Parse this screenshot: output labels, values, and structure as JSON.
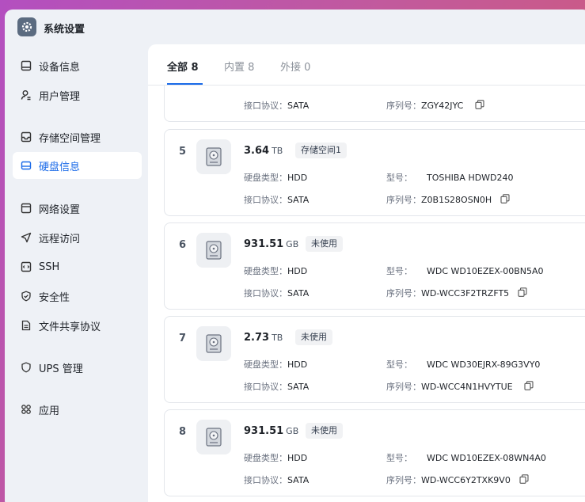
{
  "app": {
    "title": "系统设置"
  },
  "sidebar": {
    "items": [
      {
        "label": "设备信息",
        "icon": "device-info-icon"
      },
      {
        "label": "用户管理",
        "icon": "user-icon"
      },
      {
        "label": "存储空间管理",
        "icon": "storage-icon"
      },
      {
        "label": "硬盘信息",
        "icon": "disk-icon",
        "active": true
      },
      {
        "label": "网络设置",
        "icon": "network-icon"
      },
      {
        "label": "远程访问",
        "icon": "send-icon"
      },
      {
        "label": "SSH",
        "icon": "code-icon"
      },
      {
        "label": "安全性",
        "icon": "shield-icon"
      },
      {
        "label": "文件共享协议",
        "icon": "document-icon"
      },
      {
        "label": "UPS 管理",
        "icon": "ups-shield-icon"
      },
      {
        "label": "应用",
        "icon": "apps-icon"
      }
    ]
  },
  "tabs": [
    {
      "label": "全部 8",
      "active": true
    },
    {
      "label": "内置 8"
    },
    {
      "label": "外接 0"
    }
  ],
  "labels": {
    "disk_type": "硬盘类型：",
    "model": "型号：",
    "interface": "接口协议：",
    "serial": "序列号："
  },
  "partial_disk": {
    "interface": "SATA",
    "serial": "ZGY42JYC"
  },
  "disks": [
    {
      "index": "5",
      "size": "3.64",
      "unit": "TB",
      "status": "存储空间1",
      "type": "HDD",
      "model": "TOSHIBA HDWD240",
      "interface": "SATA",
      "serial": "Z0B1S28OSN0H"
    },
    {
      "index": "6",
      "size": "931.51",
      "unit": "GB",
      "status": "未使用",
      "type": "HDD",
      "model": "WDC WD10EZEX-00BN5A0",
      "interface": "SATA",
      "serial": "WD-WCC3F2TRZFT5"
    },
    {
      "index": "7",
      "size": "2.73",
      "unit": "TB",
      "status": "未使用",
      "type": "HDD",
      "model": "WDC WD30EJRX-89G3VY0",
      "interface": "SATA",
      "serial": "WD-WCC4N1HVYTUE"
    },
    {
      "index": "8",
      "size": "931.51",
      "unit": "GB",
      "status": "未使用",
      "type": "HDD",
      "model": "WDC WD10EZEX-08WN4A0",
      "interface": "SATA",
      "serial": "WD-WCC6Y2TXK9V0"
    }
  ],
  "colors": {
    "accent": "#1a6ae8",
    "sidebar_bg": "#eef1f6"
  }
}
